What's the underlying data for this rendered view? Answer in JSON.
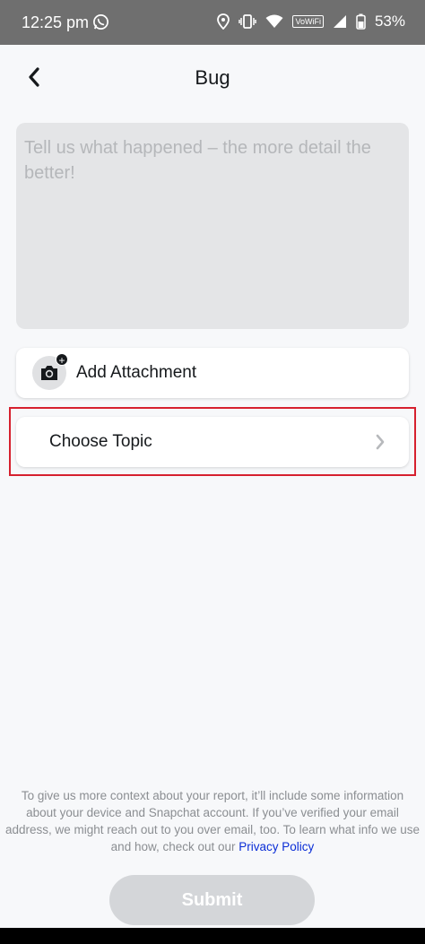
{
  "status_bar": {
    "time": "12:25 pm",
    "vowifi": "VoWiFi",
    "battery": "53%"
  },
  "header": {
    "title": "Bug"
  },
  "description": {
    "placeholder": "Tell us what happened – the more detail the better!",
    "value": ""
  },
  "attachment": {
    "label": "Add Attachment"
  },
  "topic": {
    "label": "Choose Topic"
  },
  "footer": {
    "info_text": "To give us more context about your report, it’ll include some information about your device and Snapchat account. If you’ve verified your email address, we might reach out to you over email, too. To learn what info we use and how, check out our",
    "privacy_link": "Privacy Policy"
  },
  "submit": {
    "label": "Submit"
  },
  "colors": {
    "highlight": "#d6202e",
    "link": "#0a2dd6",
    "submit_disabled": "#d4d6d9"
  }
}
